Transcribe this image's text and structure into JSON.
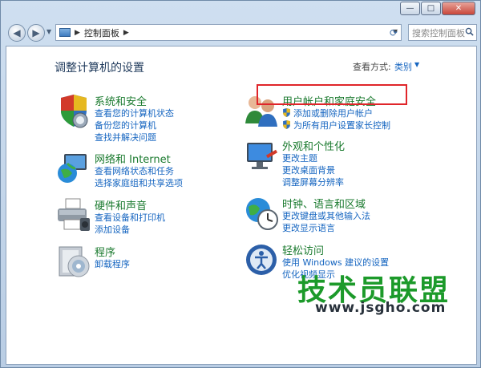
{
  "window": {
    "buttons": [
      "—",
      "□",
      "✕"
    ]
  },
  "address": {
    "crumb": "控制面板",
    "search_placeholder": "搜索控制面板"
  },
  "main": {
    "heading": "调整计算机的设置",
    "view_by_label": "查看方式:",
    "view_by_value": "类别"
  },
  "categories": [
    {
      "icon": "shield-icon",
      "title": "系统和安全",
      "links": [
        "查看您的计算机状态",
        "备份您的计算机",
        "查找并解决问题"
      ]
    },
    {
      "icon": "network-globe-icon",
      "title": "网络和 Internet",
      "links": [
        "查看网络状态和任务",
        "选择家庭组和共享选项"
      ]
    },
    {
      "icon": "printer-icon",
      "title": "硬件和声音",
      "links": [
        "查看设备和打印机",
        "添加设备"
      ]
    },
    {
      "icon": "programs-cd-icon",
      "title": "程序",
      "links": [
        "卸载程序"
      ]
    },
    {
      "icon": "users-icon",
      "title": "用户帐户和家庭安全",
      "links": [
        "添加或删除用户帐户",
        "为所有用户设置家长控制"
      ]
    },
    {
      "icon": "display-personalize-icon",
      "title": "外观和个性化",
      "links": [
        "更改主题",
        "更改桌面背景",
        "调整屏幕分辨率"
      ]
    },
    {
      "icon": "clock-globe-icon",
      "title": "时钟、语言和区域",
      "links": [
        "更改键盘或其他输入法",
        "更改显示语言"
      ]
    },
    {
      "icon": "ease-of-access-icon",
      "title": "轻松访问",
      "links": [
        "使用 Windows 建议的设置",
        "优化视频显示"
      ]
    }
  ],
  "watermark": {
    "main": "技术员联盟",
    "url": "www.jsgho.com"
  },
  "colors": {
    "category_title": "#1a7a2e",
    "link": "#1565c0",
    "highlight": "#e0252a"
  }
}
